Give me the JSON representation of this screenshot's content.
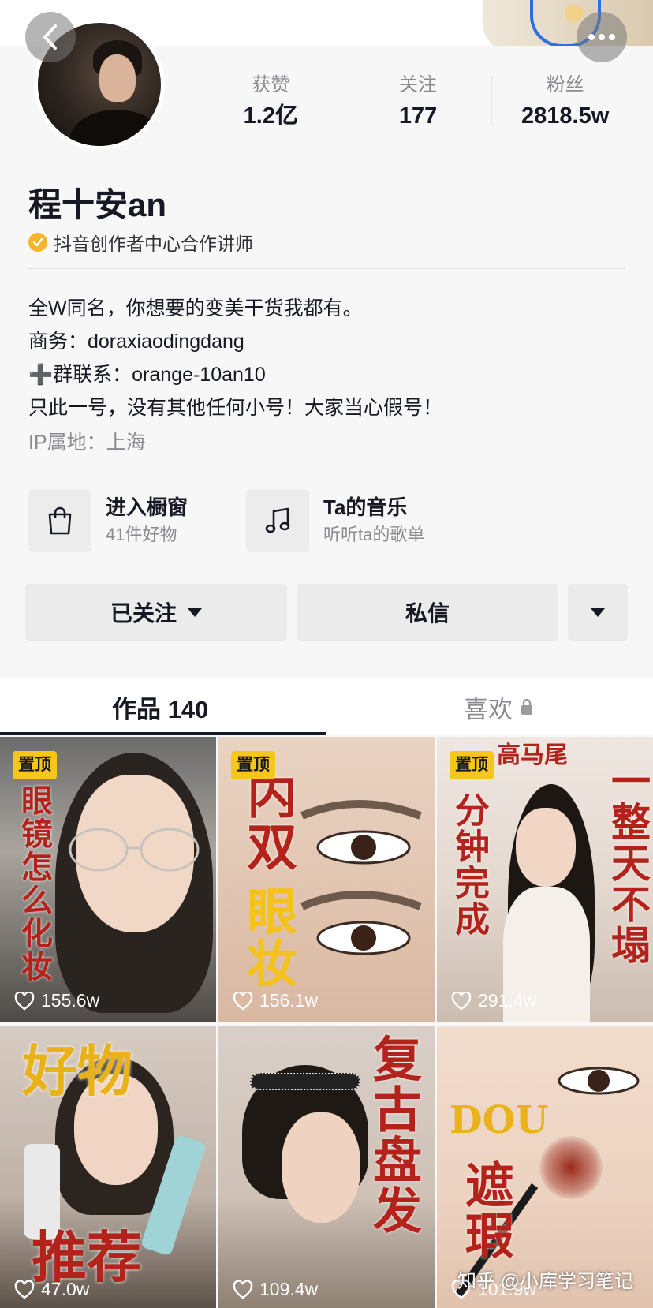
{
  "stats": [
    {
      "label": "获赞",
      "value": "1.2亿"
    },
    {
      "label": "关注",
      "value": "177"
    },
    {
      "label": "粉丝",
      "value": "2818.5w"
    }
  ],
  "profile": {
    "name": "程十安an",
    "certification": "抖音创作者中心合作讲师"
  },
  "bio": {
    "line1": "全W同名，你想要的变美干货我都有。",
    "line2": "商务：doraxiaodingdang",
    "line3": "➕群联系：orange-10an10",
    "line4": "只此一号，没有其他任何小号！大家当心假号！",
    "ip": "IP属地：上海"
  },
  "entries": {
    "shop": {
      "title": "进入橱窗",
      "subtitle": "41件好物"
    },
    "music": {
      "title": "Ta的音乐",
      "subtitle": "听听ta的歌单"
    }
  },
  "actions": {
    "follow": "已关注",
    "message": "私信"
  },
  "tabs": {
    "works": "作品 140",
    "likes": "喜欢"
  },
  "videos": [
    {
      "pinned": "置顶",
      "overlay": "眼镜怎么化妆",
      "likes": "155.6w"
    },
    {
      "pinned": "置顶",
      "overlay_top": "内双",
      "overlay": "眼妆",
      "likes": "156.1w"
    },
    {
      "pinned": "置顶",
      "overlay_top": "高马尾",
      "overlay_left": "分钟完成",
      "overlay_right": "一整天不塌",
      "likes": "291.4w"
    },
    {
      "overlay_top": "好物",
      "overlay": "推荐",
      "likes": "47.0w"
    },
    {
      "overlay": "复古盘发",
      "likes": "109.4w"
    },
    {
      "overlay_top": "DOU",
      "overlay": "遮瑕",
      "likes": "101.9w"
    }
  ],
  "watermark": "知乎 @小库学习笔记",
  "colors": {
    "pin_badge": "#f6c61a",
    "cert_badge": "#f5b52b",
    "overlay_red": "#b3231c"
  }
}
